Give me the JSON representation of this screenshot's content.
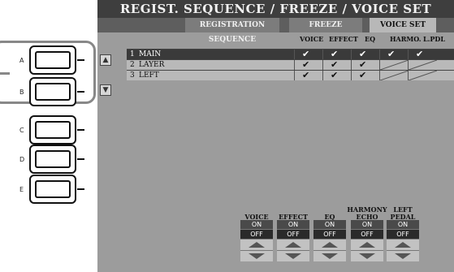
{
  "panel_buttons": [
    {
      "letter": "A"
    },
    {
      "letter": "B"
    },
    {
      "letter": "C"
    },
    {
      "letter": "D"
    },
    {
      "letter": "E"
    }
  ],
  "screen": {
    "title": "REGIST. SEQUENCE / FREEZE / VOICE SET",
    "tabs": [
      {
        "label": "REGISTRATION SEQUENCE"
      },
      {
        "label": "FREEZE"
      },
      {
        "label": "VOICE SET"
      }
    ],
    "columns": [
      "VOICE",
      "EFFECT",
      "EQ",
      "HARMO.",
      "L.PDL"
    ],
    "rows": [
      {
        "num": "1",
        "name": "MAIN",
        "checks": [
          true,
          true,
          true,
          true,
          true
        ]
      },
      {
        "num": "2",
        "name": "LAYER",
        "checks": [
          true,
          true,
          true,
          false,
          false
        ]
      },
      {
        "num": "3",
        "name": "LEFT",
        "checks": [
          true,
          true,
          true,
          false,
          false
        ]
      }
    ],
    "controls": [
      {
        "label": "VOICE",
        "on": "ON",
        "off": "OFF"
      },
      {
        "label": "EFFECT",
        "on": "ON",
        "off": "OFF"
      },
      {
        "label": "EQ",
        "on": "ON",
        "off": "OFF"
      },
      {
        "label": "HARMONY\nECHO",
        "on": "ON",
        "off": "OFF"
      },
      {
        "label": "LEFT\nPEDAL",
        "on": "ON",
        "off": "OFF"
      }
    ],
    "check_mark": "✔",
    "cursor_up_icon": "triangle-up",
    "cursor_down_icon": "triangle-down"
  }
}
